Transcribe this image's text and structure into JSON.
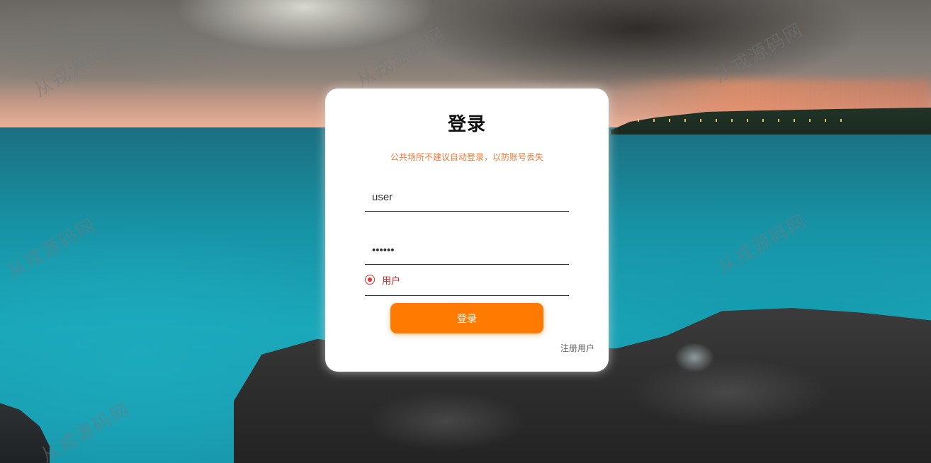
{
  "login": {
    "title": "登录",
    "tip": "公共场所不建议自动登录，以防账号丢失",
    "username_value": "user",
    "password_value": "123456",
    "role_label": "用户",
    "role_selected": true,
    "submit_label": "登录",
    "register_label": "注册用户"
  },
  "watermark": {
    "text": "从戎源码网"
  },
  "colors": {
    "accent": "#ff7a00",
    "tip": "#f07a3a",
    "role": "#d81e1e"
  }
}
